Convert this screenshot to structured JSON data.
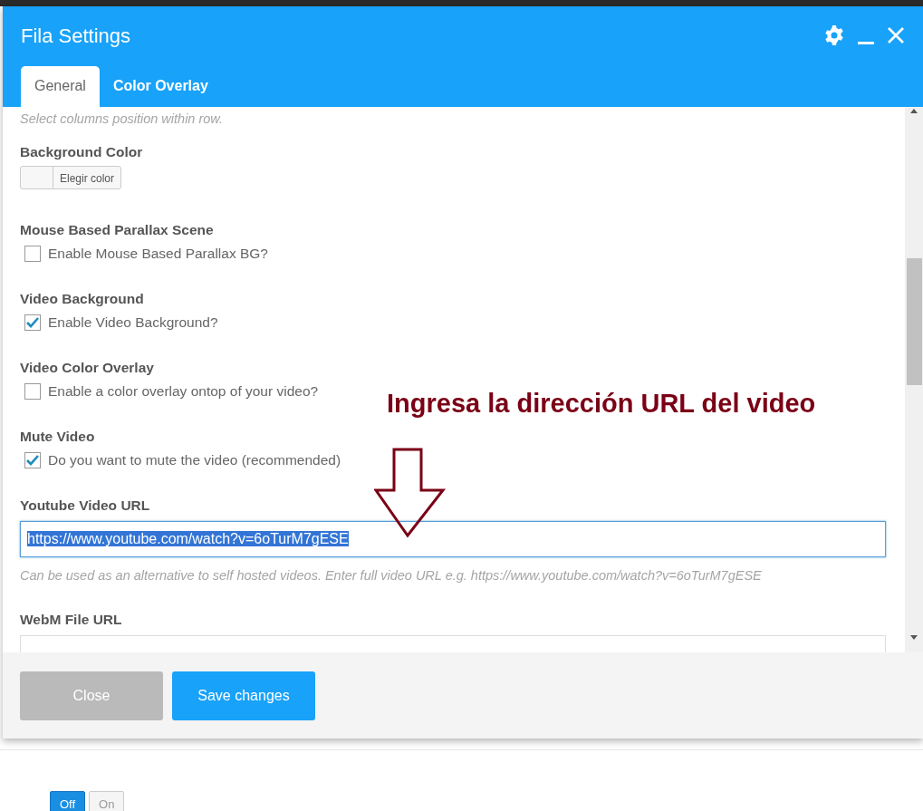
{
  "dialog": {
    "title": "Fila Settings",
    "tabs": [
      {
        "label": "General",
        "selected": true
      },
      {
        "label": "Color Overlay",
        "selected": false
      }
    ],
    "intro_hint": "Select columns position within row.",
    "fields": [
      {
        "kind": "color",
        "label": "Background Color",
        "button": "Elegir color"
      },
      {
        "kind": "checkbox",
        "label": "Mouse Based Parallax Scene",
        "option": "Enable Mouse Based Parallax BG?",
        "checked": false
      },
      {
        "kind": "checkbox",
        "label": "Video Background",
        "option": "Enable Video Background?",
        "checked": true
      },
      {
        "kind": "checkbox",
        "label": "Video Color Overlay",
        "option": "Enable a color overlay ontop of your video?",
        "checked": false
      },
      {
        "kind": "checkbox",
        "label": "Mute Video",
        "option": "Do you want to mute the video (recommended)",
        "checked": true
      },
      {
        "kind": "text",
        "label": "Youtube Video URL",
        "value": "https://www.youtube.com/watch?v=6oTurM7gESE",
        "highlighted": true,
        "help": "Can be used as an alternative to self hosted videos. Enter full video URL e.g. https://www.youtube.com/watch?v=6oTurM7gESE"
      },
      {
        "kind": "text",
        "label": "WebM File URL",
        "highlighted": false
      }
    ],
    "buttons": [
      {
        "label": "Close",
        "kind": "secondary"
      },
      {
        "label": "Save changes",
        "kind": "primary"
      }
    ]
  },
  "annotation": {
    "text": "Ingresa la dirección URL del video"
  },
  "toggle": [
    {
      "label": "Off",
      "selected": true
    },
    {
      "label": "On",
      "selected": false
    }
  ]
}
